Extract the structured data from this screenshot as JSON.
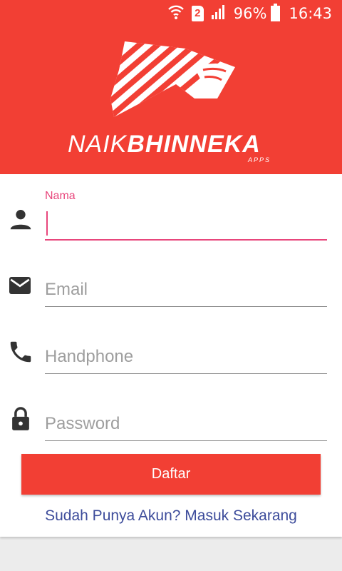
{
  "status_bar": {
    "sim_slot": "2",
    "battery": "96%",
    "time": "16:43",
    "icons": [
      "wifi-icon",
      "sim-icon",
      "signal-icon",
      "battery-icon"
    ]
  },
  "brand": {
    "name_light": "NAIK",
    "name_bold": "BHINNEKA",
    "sub": "APPS"
  },
  "form": {
    "name": {
      "label": "Nama",
      "value": "",
      "icon": "person-icon"
    },
    "email": {
      "placeholder": "Email",
      "icon": "mail-icon"
    },
    "phone": {
      "placeholder": "Handphone",
      "icon": "phone-icon"
    },
    "password": {
      "placeholder": "Password",
      "icon": "lock-icon"
    }
  },
  "actions": {
    "register_label": "Daftar",
    "login_link": "Sudah Punya Akun? Masuk Sekarang"
  },
  "colors": {
    "primary": "#f23f34",
    "accent": "#e8467c",
    "link": "#3d4c9b"
  }
}
